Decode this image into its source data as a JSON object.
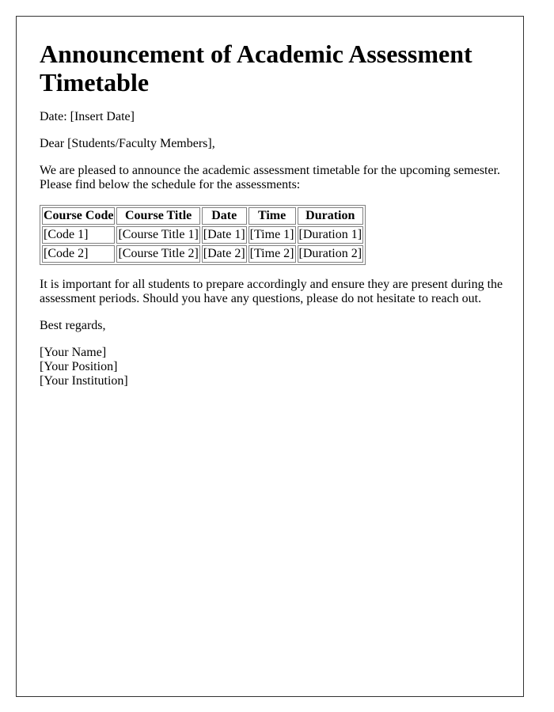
{
  "letter": {
    "title": "Announcement of Academic Assessment Timetable",
    "date_line": "Date: [Insert Date]",
    "salutation": "Dear [Students/Faculty Members],",
    "intro": "We are pleased to announce the academic assessment timetable for the upcoming semester. Please find below the schedule for the assessments:",
    "table": {
      "headers": [
        "Course Code",
        "Course Title",
        "Date",
        "Time",
        "Duration"
      ],
      "rows": [
        [
          "[Code 1]",
          "[Course Title 1]",
          "[Date 1]",
          "[Time 1]",
          "[Duration 1]"
        ],
        [
          "[Code 2]",
          "[Course Title 2]",
          "[Date 2]",
          "[Time 2]",
          "[Duration 2]"
        ]
      ]
    },
    "closing_paragraph": "It is important for all students to prepare accordingly and ensure they are present during the assessment periods. Should you have any questions, please do not hesitate to reach out.",
    "sign_off": "Best regards,",
    "signature": {
      "name": "[Your Name]",
      "position": "[Your Position]",
      "institution": "[Your Institution]"
    }
  }
}
